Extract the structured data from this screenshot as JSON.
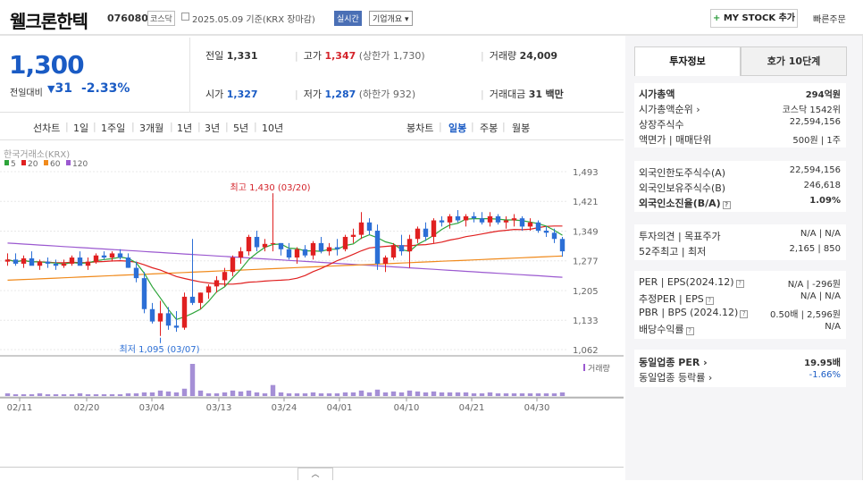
{
  "header": {
    "name": "웰크론한텍",
    "code": "076080",
    "market": "코스닥",
    "date": "2025.05.09 기준(KRX 장마감)",
    "live": "실시간",
    "corp_info": "기업개요 ▾",
    "mystock": "MY STOCK 추가",
    "quick": "빠른주문"
  },
  "quote": {
    "price": "1,300",
    "diff_label": "전일대비",
    "diff": "31",
    "diff_pct": "-2.33%",
    "prev_label": "전일",
    "prev": "1,331",
    "high_label": "고가",
    "high": "1,347",
    "upper_limit": "(상한가 1,730)",
    "volume_label": "거래량",
    "volume": "24,009",
    "open_label": "시가",
    "open": "1,327",
    "low_label": "저가",
    "low": "1,287",
    "lower_limit": "(하한가 932)",
    "amount_label": "거래대금",
    "amount": "31",
    "amount_unit": "백만"
  },
  "periods": {
    "line_label": "선차트",
    "line": [
      "1일",
      "1주일",
      "3개월",
      "1년",
      "3년",
      "5년",
      "10년"
    ],
    "candle_label": "봉차트",
    "candle": [
      "일봉",
      "주봉",
      "월봉"
    ],
    "active": "일봉"
  },
  "chart_data": {
    "type": "candlestick",
    "exchange_label": "한국거래소(KRX)",
    "legend": [
      {
        "name": "5",
        "color": "#2ea43a"
      },
      {
        "name": "20",
        "color": "#e02020"
      },
      {
        "name": "60",
        "color": "#f08a1c"
      },
      {
        "name": "120",
        "color": "#9b59d0"
      }
    ],
    "y_ticks": [
      "1,493",
      "1,421",
      "1,349",
      "1,277",
      "1,205",
      "1,133",
      "1,062"
    ],
    "ylim": [
      1062,
      1493
    ],
    "x_ticks": [
      "02/11",
      "02/20",
      "03/04",
      "03/13",
      "03/24",
      "04/01",
      "04/10",
      "04/21",
      "04/30"
    ],
    "max_annotation": "최고 1,430 (03/20)",
    "min_annotation": "최저 1,095 (03/07)",
    "volume_label": "거래량",
    "candles": [
      [
        1275,
        1295,
        1265,
        1280
      ],
      [
        1280,
        1295,
        1265,
        1270
      ],
      [
        1270,
        1290,
        1260,
        1283
      ],
      [
        1283,
        1300,
        1275,
        1265
      ],
      [
        1265,
        1280,
        1255,
        1275
      ],
      [
        1275,
        1285,
        1260,
        1270
      ],
      [
        1270,
        1280,
        1255,
        1265
      ],
      [
        1265,
        1280,
        1260,
        1270
      ],
      [
        1270,
        1290,
        1265,
        1285
      ],
      [
        1285,
        1300,
        1270,
        1265
      ],
      [
        1265,
        1285,
        1255,
        1275
      ],
      [
        1275,
        1295,
        1270,
        1290
      ],
      [
        1290,
        1300,
        1280,
        1285
      ],
      [
        1285,
        1300,
        1275,
        1295
      ],
      [
        1295,
        1305,
        1280,
        1285
      ],
      [
        1285,
        1295,
        1260,
        1260
      ],
      [
        1260,
        1275,
        1225,
        1235
      ],
      [
        1235,
        1250,
        1150,
        1160
      ],
      [
        1160,
        1175,
        1125,
        1130
      ],
      [
        1130,
        1180,
        1095,
        1150
      ],
      [
        1150,
        1165,
        1110,
        1120
      ],
      [
        1120,
        1155,
        1105,
        1115
      ],
      [
        1115,
        1200,
        1110,
        1190
      ],
      [
        1190,
        1330,
        1170,
        1175
      ],
      [
        1175,
        1200,
        1160,
        1200
      ],
      [
        1200,
        1220,
        1185,
        1215
      ],
      [
        1215,
        1240,
        1200,
        1230
      ],
      [
        1230,
        1260,
        1215,
        1250
      ],
      [
        1250,
        1290,
        1240,
        1285
      ],
      [
        1285,
        1310,
        1270,
        1300
      ],
      [
        1300,
        1340,
        1290,
        1335
      ],
      [
        1335,
        1350,
        1300,
        1310
      ],
      [
        1310,
        1330,
        1300,
        1318
      ],
      [
        1318,
        1430,
        1300,
        1320
      ],
      [
        1320,
        1320,
        1290,
        1305
      ],
      [
        1305,
        1320,
        1280,
        1285
      ],
      [
        1285,
        1310,
        1270,
        1305
      ],
      [
        1305,
        1315,
        1285,
        1290
      ],
      [
        1290,
        1325,
        1280,
        1320
      ],
      [
        1320,
        1335,
        1295,
        1300
      ],
      [
        1300,
        1320,
        1290,
        1310
      ],
      [
        1310,
        1330,
        1290,
        1305
      ],
      [
        1305,
        1340,
        1300,
        1335
      ],
      [
        1335,
        1355,
        1320,
        1340
      ],
      [
        1340,
        1395,
        1330,
        1370
      ],
      [
        1370,
        1380,
        1340,
        1350
      ],
      [
        1350,
        1365,
        1255,
        1270
      ],
      [
        1270,
        1290,
        1250,
        1285
      ],
      [
        1285,
        1320,
        1280,
        1315
      ],
      [
        1315,
        1340,
        1290,
        1300
      ],
      [
        1300,
        1340,
        1260,
        1330
      ],
      [
        1330,
        1360,
        1320,
        1355
      ],
      [
        1355,
        1370,
        1325,
        1335
      ],
      [
        1335,
        1380,
        1320,
        1375
      ],
      [
        1375,
        1385,
        1360,
        1370
      ],
      [
        1370,
        1390,
        1355,
        1385
      ],
      [
        1385,
        1400,
        1370,
        1375
      ],
      [
        1375,
        1390,
        1360,
        1385
      ],
      [
        1385,
        1395,
        1370,
        1380
      ],
      [
        1380,
        1395,
        1365,
        1370
      ],
      [
        1370,
        1395,
        1360,
        1385
      ],
      [
        1385,
        1390,
        1365,
        1370
      ],
      [
        1370,
        1385,
        1355,
        1375
      ],
      [
        1375,
        1390,
        1360,
        1380
      ],
      [
        1380,
        1385,
        1350,
        1360
      ],
      [
        1360,
        1380,
        1350,
        1370
      ],
      [
        1370,
        1375,
        1345,
        1350
      ],
      [
        1350,
        1360,
        1335,
        1345
      ],
      [
        1345,
        1355,
        1320,
        1330
      ],
      [
        1330,
        1335,
        1287,
        1300
      ]
    ],
    "volumes": [
      3,
      2,
      2,
      2,
      3,
      2,
      2,
      2,
      2,
      3,
      2,
      2,
      2,
      2,
      2,
      3,
      3,
      4,
      4,
      6,
      5,
      4,
      8,
      35,
      6,
      3,
      3,
      4,
      6,
      5,
      6,
      4,
      3,
      12,
      4,
      3,
      3,
      3,
      4,
      3,
      3,
      3,
      4,
      4,
      6,
      4,
      7,
      4,
      5,
      4,
      6,
      5,
      4,
      5,
      4,
      4,
      4,
      4,
      3,
      3,
      4,
      3,
      3,
      3,
      3,
      3,
      3,
      3,
      3,
      4
    ]
  },
  "right": {
    "tabs": [
      "투자정보",
      "호가 10단계"
    ],
    "group1": [
      {
        "k": "시가총액",
        "v": "294억원",
        "bold": true
      },
      {
        "k": "시가총액순위 ›",
        "v": "코스닥 1542위"
      },
      {
        "k": "상장주식수",
        "v": "22,594,156"
      },
      {
        "k": "액면가 | 매매단위",
        "v": "500원 | 1주"
      }
    ],
    "group2": [
      {
        "k": "외국인한도주식수(A)",
        "v": "22,594,156"
      },
      {
        "k": "외국인보유주식수(B)",
        "v": "246,618"
      },
      {
        "k": "외국인소진율(B/A)",
        "v": "1.09%",
        "bold": true,
        "qm": true
      }
    ],
    "group3": [
      {
        "k": "투자의견 | 목표주가",
        "v": "N/A | N/A"
      },
      {
        "k": "52주최고 | 최저",
        "v": "2,165 | 850"
      }
    ],
    "group4": [
      {
        "k": "PER | EPS(2024.12)",
        "v": "N/A | -296원",
        "qm": true
      },
      {
        "k": "추정PER | EPS",
        "v": "N/A | N/A",
        "qm": true
      },
      {
        "k": "PBR | BPS (2024.12)",
        "v": "0.50배 | 2,596원",
        "qm": true
      },
      {
        "k": "배당수익률",
        "v": "N/A",
        "qm": true
      }
    ],
    "group5": [
      {
        "k": "동일업종 PER ›",
        "v": "19.95배",
        "bold": true
      },
      {
        "k": "동일업종 등락률 ›",
        "v": "-1.66%",
        "blue": true
      }
    ]
  }
}
